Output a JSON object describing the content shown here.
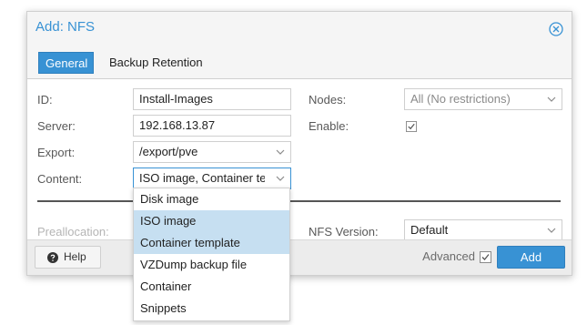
{
  "dialog": {
    "title": "Add: NFS",
    "close_icon": "close-circle-icon",
    "accent": "#3892d4"
  },
  "tabs": [
    {
      "label": "General",
      "active": true
    },
    {
      "label": "Backup Retention",
      "active": false
    }
  ],
  "form": {
    "id_label": "ID:",
    "id_value": "Install-Images",
    "server_label": "Server:",
    "server_value": "192.168.13.87",
    "export_label": "Export:",
    "export_value": "/export/pve",
    "content_label": "Content:",
    "content_value": "ISO image, Container template",
    "nodes_label": "Nodes:",
    "nodes_value": "All (No restrictions)",
    "enable_label": "Enable:",
    "enable_checked": true,
    "preallocation_label": "Preallocation:",
    "nfs_version_label": "NFS Version:",
    "nfs_version_value": "Default"
  },
  "content_dropdown": {
    "options": [
      {
        "label": "Disk image",
        "selected": false
      },
      {
        "label": "ISO image",
        "selected": true
      },
      {
        "label": "Container template",
        "selected": true
      },
      {
        "label": "VZDump backup file",
        "selected": false
      },
      {
        "label": "Container",
        "selected": false
      },
      {
        "label": "Snippets",
        "selected": false
      }
    ]
  },
  "footer": {
    "help_label": "Help",
    "advanced_label": "Advanced",
    "advanced_checked": true,
    "add_label": "Add"
  }
}
